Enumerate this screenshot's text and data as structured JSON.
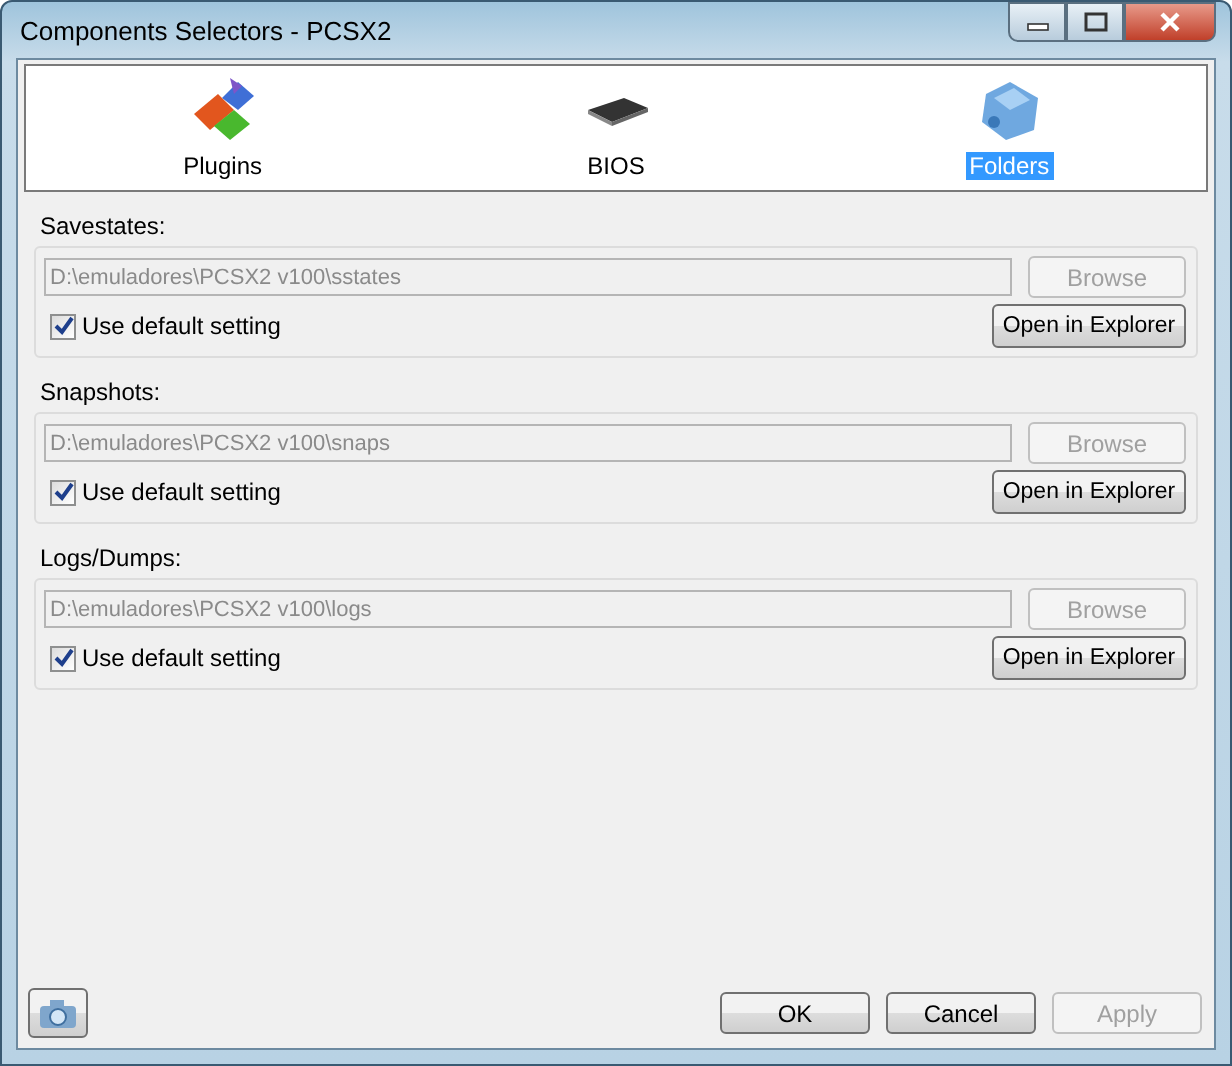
{
  "window": {
    "title": "Components Selectors - PCSX2"
  },
  "tabs": [
    {
      "label": "Plugins",
      "kind": "plugins",
      "selected": false
    },
    {
      "label": "BIOS",
      "kind": "chip",
      "selected": false
    },
    {
      "label": "Folders",
      "kind": "folders",
      "selected": true
    }
  ],
  "sections": [
    {
      "label": "Savestates:",
      "path": "D:\\emuladores\\PCSX2 v100\\sstates",
      "path_disabled": true,
      "browse": {
        "label": "Browse",
        "disabled": true
      },
      "checkbox": {
        "label": "Use default setting",
        "checked": true
      },
      "open_button": "Open in Explorer"
    },
    {
      "label": "Snapshots:",
      "path": "D:\\emuladores\\PCSX2 v100\\snaps",
      "path_disabled": true,
      "browse": {
        "label": "Browse",
        "disabled": true
      },
      "checkbox": {
        "label": "Use default setting",
        "checked": true
      },
      "open_button": "Open in Explorer"
    },
    {
      "label": "Logs/Dumps:",
      "path": "D:\\emuladores\\PCSX2 v100\\logs",
      "path_disabled": true,
      "browse": {
        "label": "Browse",
        "disabled": true
      },
      "checkbox": {
        "label": "Use default setting",
        "checked": true
      },
      "open_button": "Open in Explorer"
    }
  ],
  "buttons": [
    {
      "label": "OK",
      "disabled": false
    },
    {
      "label": "Cancel",
      "disabled": false
    },
    {
      "label": "Apply",
      "disabled": true
    }
  ]
}
